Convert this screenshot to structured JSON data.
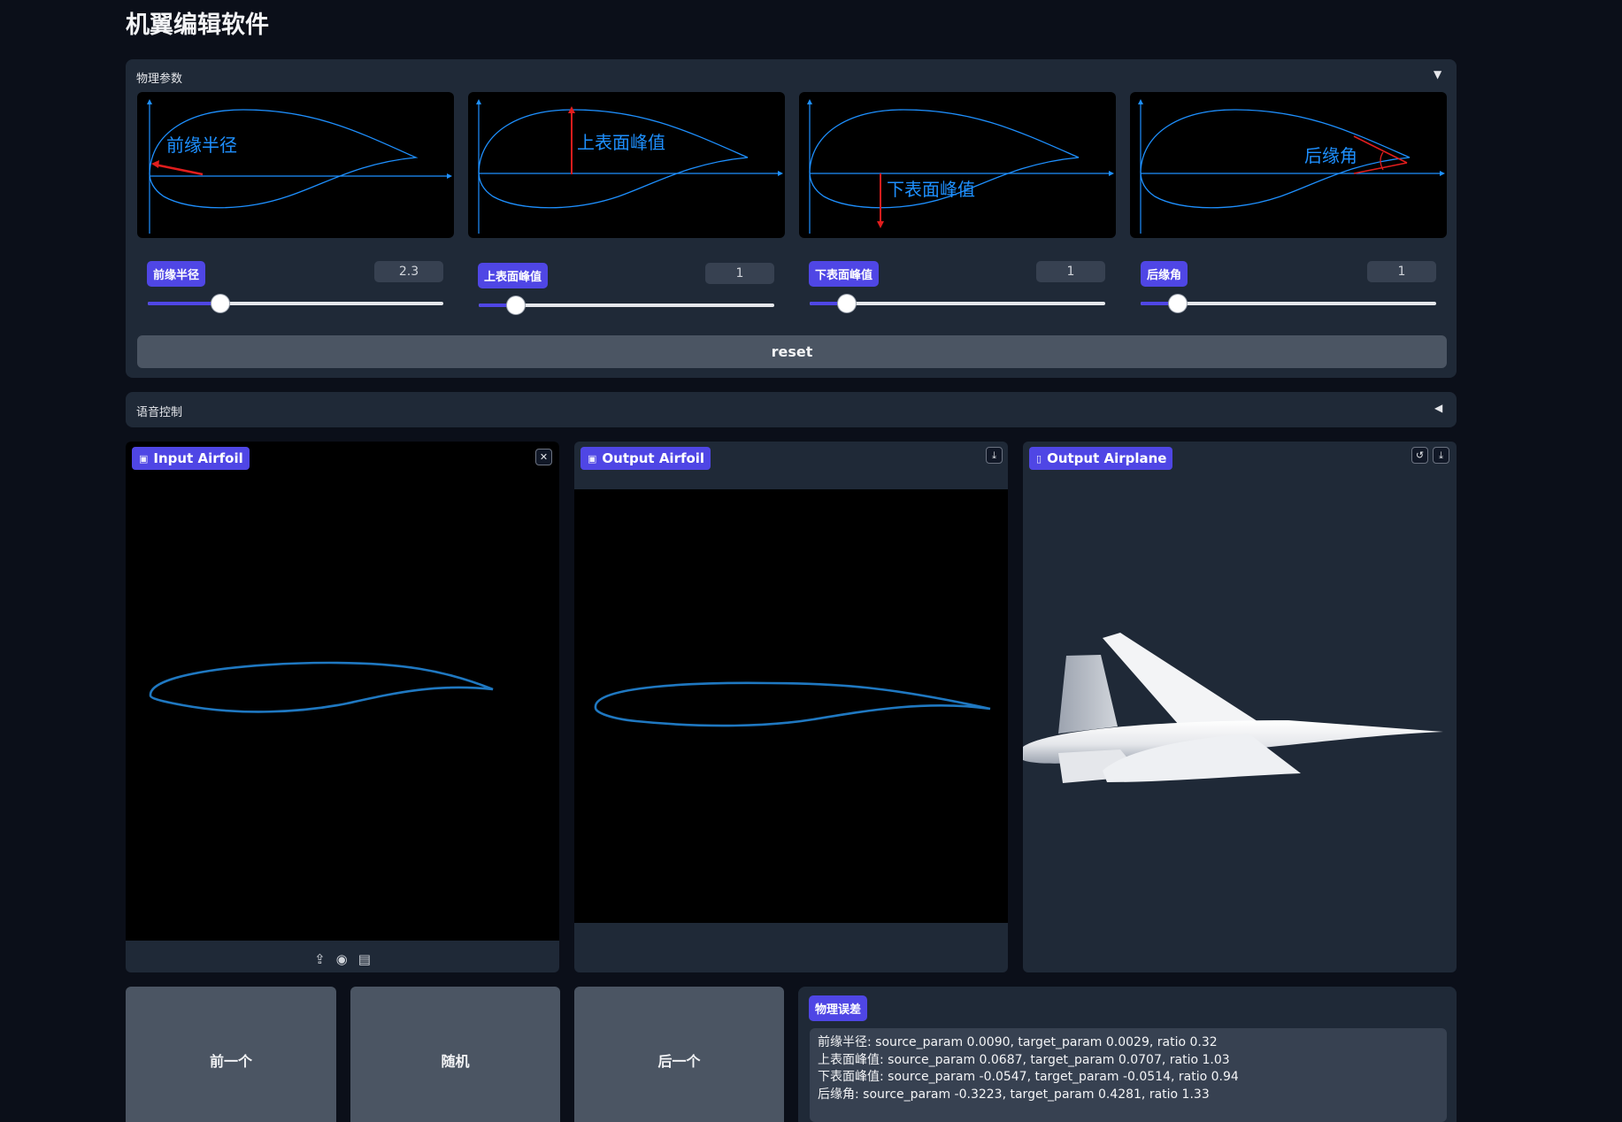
{
  "app": {
    "title": "机翼编辑软件"
  },
  "physics": {
    "section_label": "物理参数",
    "collapse_icon": "triangle-down-icon",
    "illustrations": [
      {
        "label": "前缘半径"
      },
      {
        "label": "上表面峰值"
      },
      {
        "label": "下表面峰值"
      },
      {
        "label": "后缘角"
      }
    ],
    "params": [
      {
        "label": "前缘半径",
        "value": "2.3",
        "fraction": 0.245
      },
      {
        "label": "上表面峰值",
        "value": "1",
        "fraction": 0.125
      },
      {
        "label": "下表面峰值",
        "value": "1",
        "fraction": 0.125
      },
      {
        "label": "后缘角",
        "value": "1",
        "fraction": 0.125
      }
    ],
    "reset_label": "reset"
  },
  "voice": {
    "section_label": "语音控制",
    "expand_icon": "triangle-left-icon"
  },
  "input_airfoil": {
    "label": "Input Airfoil",
    "icon": "image-icon"
  },
  "output_airfoil": {
    "label": "Output Airfoil",
    "icon": "image-icon"
  },
  "output_airplane": {
    "label": "Output Airplane",
    "icon": "file-icon"
  },
  "nav": {
    "prev_label": "前一个",
    "random_label": "随机",
    "next_label": "后一个"
  },
  "errors": {
    "label": "物理误差",
    "lines": [
      "前缘半径: source_param 0.0090, target_param 0.0029, ratio 0.32",
      "上表面峰值: source_param 0.0687, target_param 0.0707, ratio 1.03",
      "下表面峰值: source_param -0.0547, target_param -0.0514, ratio 0.94",
      "后缘角: source_param -0.3223, target_param 0.4281, ratio 1.33"
    ]
  },
  "colors": {
    "accent": "#4f46e5",
    "background": "#0b0f19",
    "panel": "#1f2937",
    "curve": "#1e90ff",
    "annotation": "#e11d1d"
  }
}
